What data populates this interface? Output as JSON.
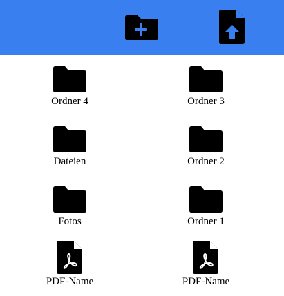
{
  "toolbar": {
    "background_color": "#3a7ff0",
    "actions": [
      {
        "name": "new-folder",
        "icon": "folder-plus-icon"
      },
      {
        "name": "upload-file",
        "icon": "file-upload-icon"
      }
    ]
  },
  "grid": {
    "items": [
      {
        "label": "Ordner 4",
        "type": "folder",
        "icon": "folder-icon"
      },
      {
        "label": "Ordner 3",
        "type": "folder",
        "icon": "folder-icon"
      },
      {
        "label": "Dateien",
        "type": "folder",
        "icon": "folder-icon"
      },
      {
        "label": "Ordner 2",
        "type": "folder",
        "icon": "folder-icon"
      },
      {
        "label": "Fotos",
        "type": "folder",
        "icon": "folder-icon"
      },
      {
        "label": "Ordner 1",
        "type": "folder",
        "icon": "folder-icon"
      },
      {
        "label": "PDF-Name",
        "type": "pdf",
        "icon": "pdf-file-icon"
      },
      {
        "label": "PDF-Name",
        "type": "pdf",
        "icon": "pdf-file-icon"
      }
    ]
  }
}
